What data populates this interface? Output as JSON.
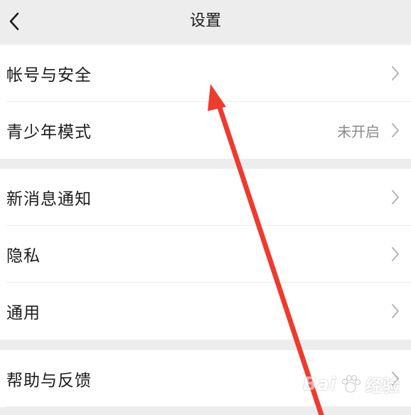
{
  "header": {
    "title": "设置"
  },
  "groups": [
    {
      "items": [
        {
          "label": "帐号与安全",
          "value": ""
        },
        {
          "label": "青少年模式",
          "value": "未开启"
        }
      ]
    },
    {
      "items": [
        {
          "label": "新消息通知",
          "value": ""
        },
        {
          "label": "隐私",
          "value": ""
        },
        {
          "label": "通用",
          "value": ""
        }
      ]
    },
    {
      "items": [
        {
          "label": "帮助与反馈",
          "value": ""
        }
      ]
    }
  ],
  "watermark": {
    "brand": "Bai",
    "cn": "经验"
  },
  "colors": {
    "annotation_arrow": "#ee3b2e",
    "background": "#ededed",
    "row_background": "#ffffff",
    "secondary_text": "#8a8a8a"
  },
  "icons": {
    "back": "chevron-left-icon",
    "row_arrow": "chevron-right-icon"
  }
}
